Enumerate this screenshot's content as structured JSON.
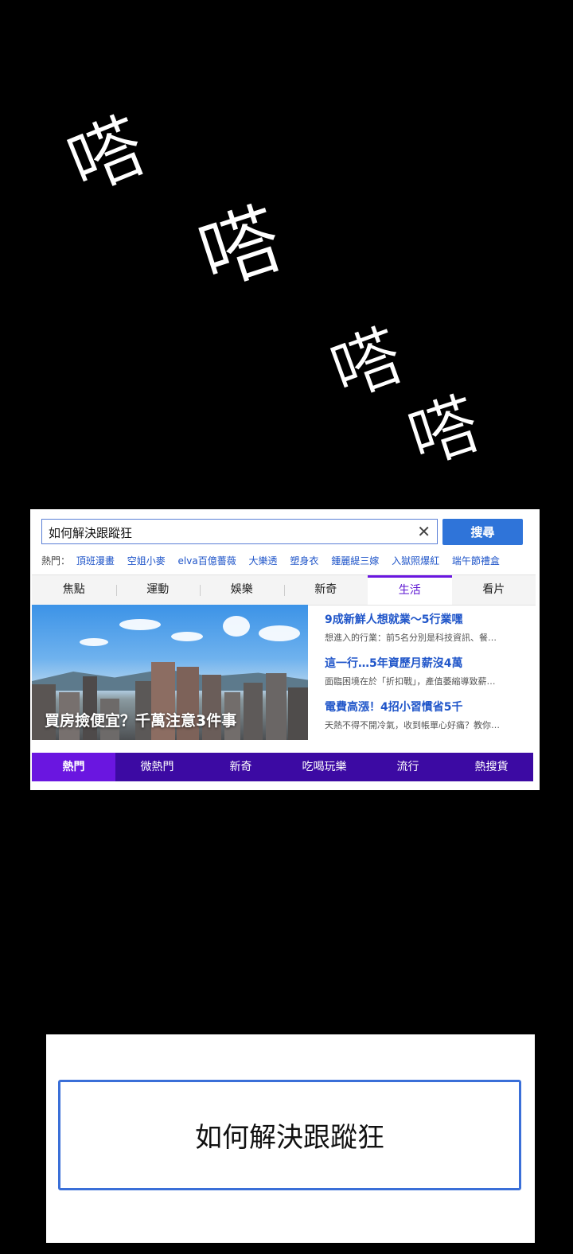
{
  "sfx": [
    "嗒",
    "嗒",
    "嗒",
    "嗒"
  ],
  "search": {
    "query": "如何解決跟蹤狂",
    "button_label": "搜尋",
    "clear_glyph": "✕"
  },
  "hot": {
    "label": "熱門：",
    "items": [
      "頂班漫畫",
      "空姐小麥",
      "elva百億薔薇",
      "大樂透",
      "塑身衣",
      "鍾麗緹三嫁",
      "入獄照爆紅",
      "端午節禮盒"
    ]
  },
  "tabs": [
    {
      "label": "焦點"
    },
    {
      "label": "運動"
    },
    {
      "label": "娛樂"
    },
    {
      "label": "新奇"
    },
    {
      "label": "生活"
    },
    {
      "label": "看片"
    }
  ],
  "active_tab": "生活",
  "hero": {
    "caption": "買房撿便宜？千萬注意3件事"
  },
  "news": [
    {
      "title": "9成新鮮人想就業～5行業嘿",
      "desc": "想進入的行業：前5名分別是科技資訊、餐…"
    },
    {
      "title": "這一行…5年資歷月薪沒4萬",
      "desc": "面臨困境在於「折扣戰」，產值萎縮導致薪…"
    },
    {
      "title": "電費高漲！4招小習慣省5千",
      "desc": "天熱不得不開冷氣，收到帳單心好痛？教你…"
    }
  ],
  "categories": [
    {
      "label": "熱門"
    },
    {
      "label": "微熱門"
    },
    {
      "label": "新奇"
    },
    {
      "label": "吃喝玩樂"
    },
    {
      "label": "流行"
    },
    {
      "label": "熱搜貨"
    }
  ],
  "active_category": "熱門",
  "bottom_box": {
    "text": "如何解決跟蹤狂"
  },
  "colors": {
    "accent_blue": "#2f74d9",
    "purple_bar": "#3c0aa3",
    "purple_active": "#6a16e0",
    "link_blue": "#1f55c9"
  }
}
